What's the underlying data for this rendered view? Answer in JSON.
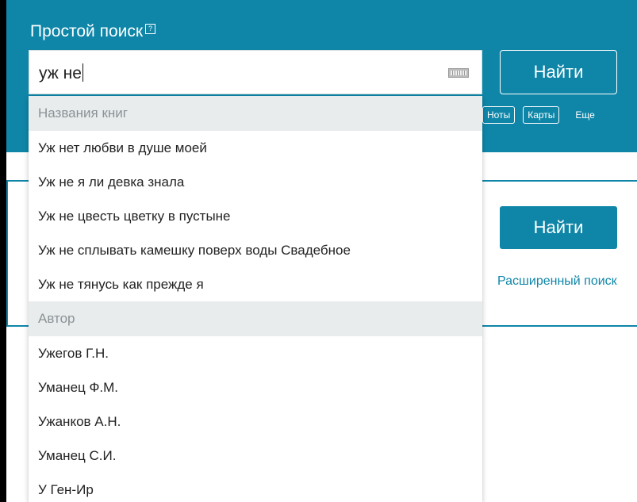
{
  "header": {
    "title": "Простой поиск",
    "help_mark": "?",
    "find_label": "Найти"
  },
  "search": {
    "value": "уж не"
  },
  "tabs": {
    "items": [
      {
        "label": "Ноты"
      },
      {
        "label": "Карты"
      }
    ],
    "more_label": "Еще"
  },
  "panel": {
    "find_label": "Найти",
    "advanced_link": "Расширенный поиск"
  },
  "suggestions": {
    "books_header": "Названия книг",
    "books": [
      "Уж нет любви в душе моей",
      "Уж не я ли девка знала",
      "Уж не цвесть цветку в пустыне",
      "Уж не сплывать камешку поверх воды Свадебное",
      "Уж не тянусь как прежде я"
    ],
    "authors_header": "Автор",
    "authors": [
      "Ужегов Г.Н.",
      "Уманец Ф.М.",
      "Ужанков А.Н.",
      "Уманец С.И.",
      "У Ген-Ир"
    ]
  }
}
